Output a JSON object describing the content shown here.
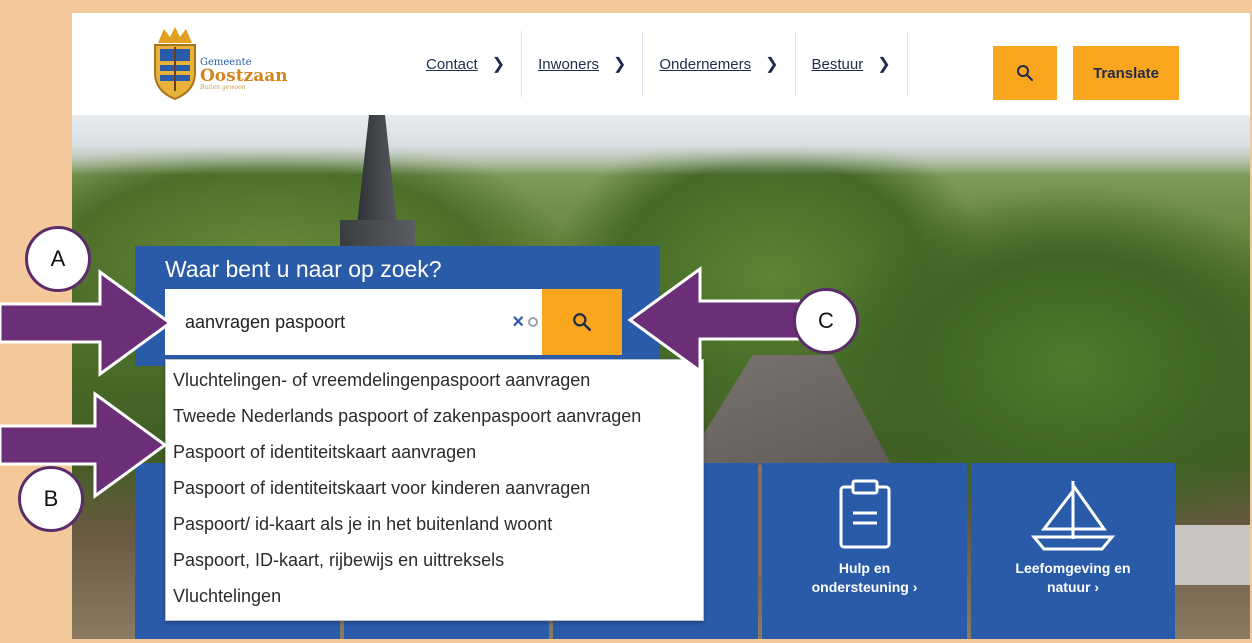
{
  "header": {
    "logo": {
      "small_text": "Gemeente",
      "name": "Oostzaan",
      "tagline": "Buiten gewoon"
    },
    "nav": [
      {
        "label": "Contact",
        "icon": "chevron-right-icon"
      },
      {
        "label": "Inwoners",
        "icon": "chevron-right-icon"
      },
      {
        "label": "Ondernemers",
        "icon": "chevron-right-icon"
      },
      {
        "label": "Bestuur",
        "icon": "chevron-right-icon"
      }
    ],
    "search_icon": "search-icon",
    "translate_label": "Translate"
  },
  "search": {
    "title": "Waar bent u naar op zoek?",
    "value": "aanvragen paspoort",
    "clear_symbol": "×",
    "submit_icon": "search-icon",
    "suggestions": [
      "Vluchtelingen- of vreemdelingenpaspoort aanvragen",
      "Tweede Nederlands paspoort of zakenpaspoort aanvragen",
      "Paspoort of identiteitskaart aanvragen",
      "Paspoort of identiteitskaart voor kinderen aanvragen",
      "Paspoort/ id-kaart als je in het buitenland woont",
      "Paspoort, ID-kaart, rijbewijs en uittreksels",
      "Vluchtelingen"
    ]
  },
  "tiles": [
    {
      "label_line1": "",
      "label_line2": ""
    },
    {
      "label_line1": "",
      "label_line2": ""
    },
    {
      "label_line1": "",
      "label_line2": ""
    },
    {
      "label_line1": "Hulp en",
      "label_line2": "ondersteuning ›",
      "icon": "clipboard-icon"
    },
    {
      "label_line1": "Leefomgeving en",
      "label_line2": "natuur ›",
      "icon": "sailboat-icon"
    }
  ],
  "annotations": {
    "a": "A",
    "b": "B",
    "c": "C"
  },
  "colors": {
    "frame_border": "#f3c89a",
    "brand_blue": "#2a5ba8",
    "accent_orange": "#f9a51e",
    "annotation_purple": "#5a2d6a"
  }
}
